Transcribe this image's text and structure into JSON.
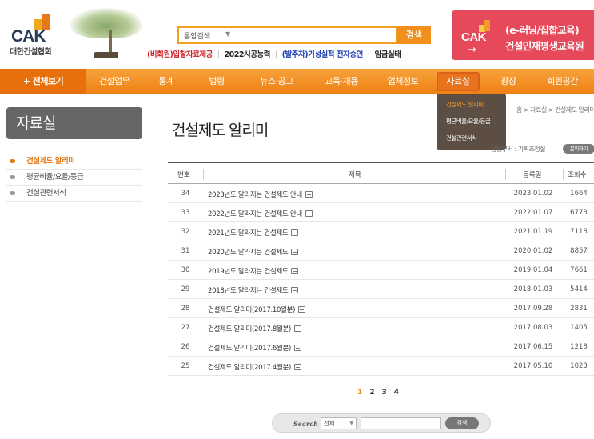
{
  "header": {
    "logo_text": "CAK",
    "org_name": "대한건설협회",
    "search": {
      "select_value": "통합검색",
      "query": "",
      "button_label": "검색"
    },
    "quick_links": [
      {
        "label": "(비회원)입찰자료제공"
      },
      {
        "label": "2022시공능력"
      },
      {
        "label": "(발주자)기성실적 전자승인"
      },
      {
        "label": "임금실태"
      }
    ],
    "edu_banner": {
      "logo_text": "CAK",
      "arrow": "→",
      "line1": "(e-러닝/집합교육)",
      "line2": "건설인재평생교육원"
    }
  },
  "nav": {
    "all_label": "+ 전체보기",
    "items": [
      {
        "label": "건설업무"
      },
      {
        "label": "통계"
      },
      {
        "label": "법령"
      },
      {
        "label": "뉴스·공고"
      },
      {
        "label": "교육·채용"
      },
      {
        "label": "업체정보"
      },
      {
        "label": "자료실"
      },
      {
        "label": "광장"
      },
      {
        "label": "회원공간"
      }
    ],
    "dropdown": [
      {
        "label": "건설제도 알리미"
      },
      {
        "label": "평균비율/요율/등급"
      },
      {
        "label": "건설관련서식"
      }
    ]
  },
  "sidebar": {
    "title": "자료실",
    "items": [
      {
        "label": "건설제도 알리미"
      },
      {
        "label": "평균비율/요율/등급"
      },
      {
        "label": "건설관련서식"
      }
    ]
  },
  "content": {
    "title": "건설제도 알리미",
    "breadcrumb": "홈 > 자료실 > 건설제도 알리미",
    "author": "담당부서 : 기획조정실",
    "inquiry_label": "문의하기",
    "table": {
      "headers": {
        "no": "번호",
        "subject": "제목",
        "date": "등록일",
        "hits": "조회수"
      },
      "rows": [
        {
          "no": "34",
          "subject": "2023년도 달라지는 건설제도 안내",
          "date": "2023.01.02",
          "hits": "1664"
        },
        {
          "no": "33",
          "subject": "2022년도 달라지는 건설제도 안내",
          "date": "2022.01.07",
          "hits": "6773"
        },
        {
          "no": "32",
          "subject": "2021년도 달라지는 건설제도",
          "date": "2021.01.19",
          "hits": "7118"
        },
        {
          "no": "31",
          "subject": "2020년도 달라지는 건설제도",
          "date": "2020.01.02",
          "hits": "8857"
        },
        {
          "no": "30",
          "subject": "2019년도 달라지는 건설제도",
          "date": "2019.01.04",
          "hits": "7661"
        },
        {
          "no": "29",
          "subject": "2018년도 달라지는 건설제도",
          "date": "2018.01.03",
          "hits": "5414"
        },
        {
          "no": "28",
          "subject": "건설제도 알리미(2017.10월분)",
          "date": "2017.09.28",
          "hits": "2831"
        },
        {
          "no": "27",
          "subject": "건설제도 알리미(2017.8월분)",
          "date": "2017.08.03",
          "hits": "1405"
        },
        {
          "no": "26",
          "subject": "건설제도 알리미(2017.6월분)",
          "date": "2017.06.15",
          "hits": "1218"
        },
        {
          "no": "25",
          "subject": "건설제도 알리미(2017.4월분)",
          "date": "2017.05.10",
          "hits": "1023"
        }
      ]
    },
    "pagination": [
      "1",
      "2",
      "3",
      "4"
    ],
    "bottom_search": {
      "label": "Search",
      "select_value": "전체",
      "query": "",
      "button_label": "검색"
    }
  },
  "colors": {
    "accent": "#f08f1c",
    "banner": "#e64a5a",
    "dropdown_bg": "#5c4e42"
  }
}
